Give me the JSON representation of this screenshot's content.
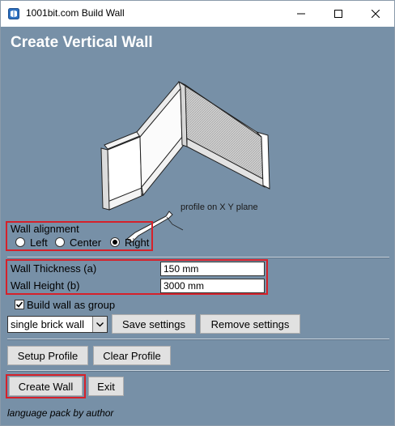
{
  "window": {
    "title": "1001bit.com Build Wall",
    "icon": "app-icon",
    "controls": [
      "minimize-icon",
      "maximize-icon",
      "close-icon"
    ]
  },
  "heading": "Create Vertical Wall",
  "illustration": {
    "profile_label": "profile on X Y plane"
  },
  "alignment": {
    "label": "Wall alignment",
    "options": [
      {
        "label": "Left",
        "checked": false
      },
      {
        "label": "Center",
        "checked": false
      },
      {
        "label": "Right",
        "checked": true
      }
    ]
  },
  "dimensions": {
    "thickness_label": "Wall Thickness (a)",
    "thickness_value": "150 mm",
    "height_label": "Wall Height (b)",
    "height_value": "3000 mm"
  },
  "group_checkbox": {
    "label": "Build wall as group",
    "checked": true
  },
  "settings": {
    "selected_preset": "single brick wall",
    "save_label": "Save settings",
    "remove_label": "Remove settings"
  },
  "profile": {
    "setup_label": "Setup Profile",
    "clear_label": "Clear Profile"
  },
  "actions": {
    "create_label": "Create Wall",
    "exit_label": "Exit"
  },
  "footer": "language pack by author",
  "colors": {
    "dialog_background": "#7790a7",
    "highlight_border": "#d6212a",
    "title_bar": "#ffffff"
  }
}
